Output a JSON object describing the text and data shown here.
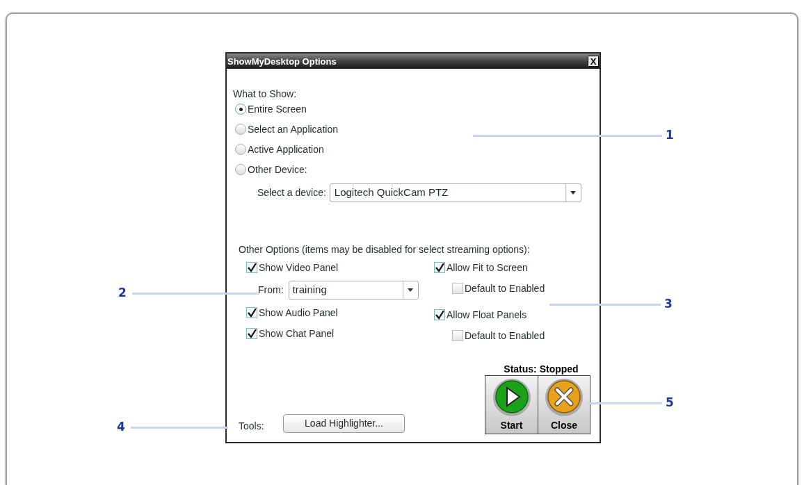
{
  "window": {
    "title": "ShowMyDesktop Options",
    "close_label": "X"
  },
  "what_to_show": {
    "label": "What to Show:",
    "options": [
      {
        "label": "Entire Screen",
        "selected": true
      },
      {
        "label": "Select an Application",
        "selected": false
      },
      {
        "label": "Active Application",
        "selected": false
      },
      {
        "label": "Other Device:",
        "selected": false
      }
    ],
    "device": {
      "label": "Select a device:",
      "value": "Logitech QuickCam PTZ"
    }
  },
  "other_options": {
    "label": "Other Options (items may be disabled for select streaming options):",
    "left": [
      {
        "kind": "checkbox",
        "label": "Show Video Panel",
        "checked": true
      },
      {
        "kind": "dropdown",
        "label": "From:",
        "value": "training"
      },
      {
        "kind": "checkbox",
        "label": "Show Audio Panel",
        "checked": true
      },
      {
        "kind": "checkbox",
        "label": "Show Chat Panel",
        "checked": true
      }
    ],
    "right": [
      {
        "label": "Allow Fit to Screen",
        "checked": true,
        "children": [
          {
            "label": "Default to Enabled",
            "checked": false
          }
        ]
      },
      {
        "label": "Allow Float Panels",
        "checked": true,
        "children": [
          {
            "label": "Default to Enabled",
            "checked": false
          }
        ]
      }
    ]
  },
  "status": "Status: Stopped",
  "buttons": [
    {
      "kind": "start",
      "label": "Start"
    },
    {
      "kind": "close",
      "label": "Close"
    }
  ],
  "tools": {
    "label": "Tools:",
    "button": "Load Highlighter..."
  },
  "callouts": [
    {
      "number": "1"
    },
    {
      "number": "2"
    },
    {
      "number": "3"
    },
    {
      "number": "4"
    },
    {
      "number": "5"
    }
  ]
}
